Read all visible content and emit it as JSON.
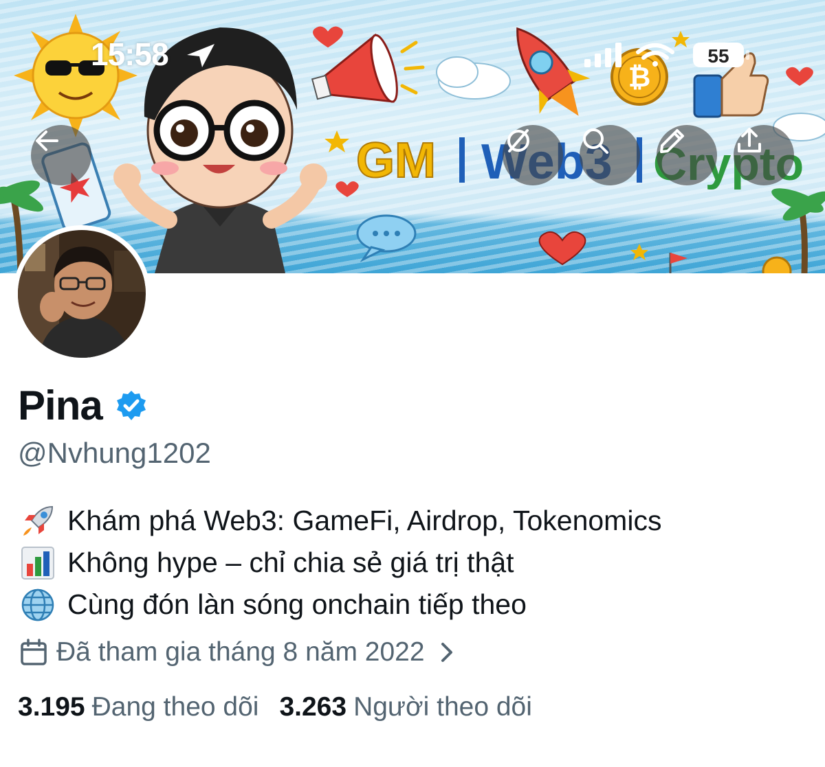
{
  "status_bar": {
    "time": "15:58",
    "battery": "55"
  },
  "header": {
    "back_icon": "arrow-left-icon",
    "mute_icon": "mute-circle-slash-icon",
    "search_icon": "search-icon",
    "edit_icon": "pencil-icon",
    "share_icon": "share-upload-icon"
  },
  "banner": {
    "logo_text_1": "GM",
    "logo_text_2": "Web3",
    "logo_text_3": "Crypto",
    "colors": {
      "gm": "#f2b705",
      "web3": "#1f5fb8",
      "crypto": "#2e9a3e"
    }
  },
  "profile": {
    "display_name": "Pina",
    "verified": true,
    "handle": "@Nvhung1202",
    "bio": [
      {
        "emoji": "rocket-icon",
        "text": "Khám phá Web3: GameFi, Airdrop, Tokenomics"
      },
      {
        "emoji": "bar-chart-icon",
        "text": "Không hype – chỉ chia sẻ giá trị thật"
      },
      {
        "emoji": "globe-icon",
        "text": "Cùng đón làn sóng onchain tiếp theo"
      }
    ],
    "joined": "Đã tham gia tháng 8 năm 2022",
    "following_count": "3.195",
    "following_label": "Đang theo dõi",
    "followers_count": "3.263",
    "followers_label": "Người theo dõi"
  },
  "colors": {
    "text_primary": "#0f1419",
    "text_secondary": "#536471",
    "verified_blue": "#1d9bf0"
  }
}
